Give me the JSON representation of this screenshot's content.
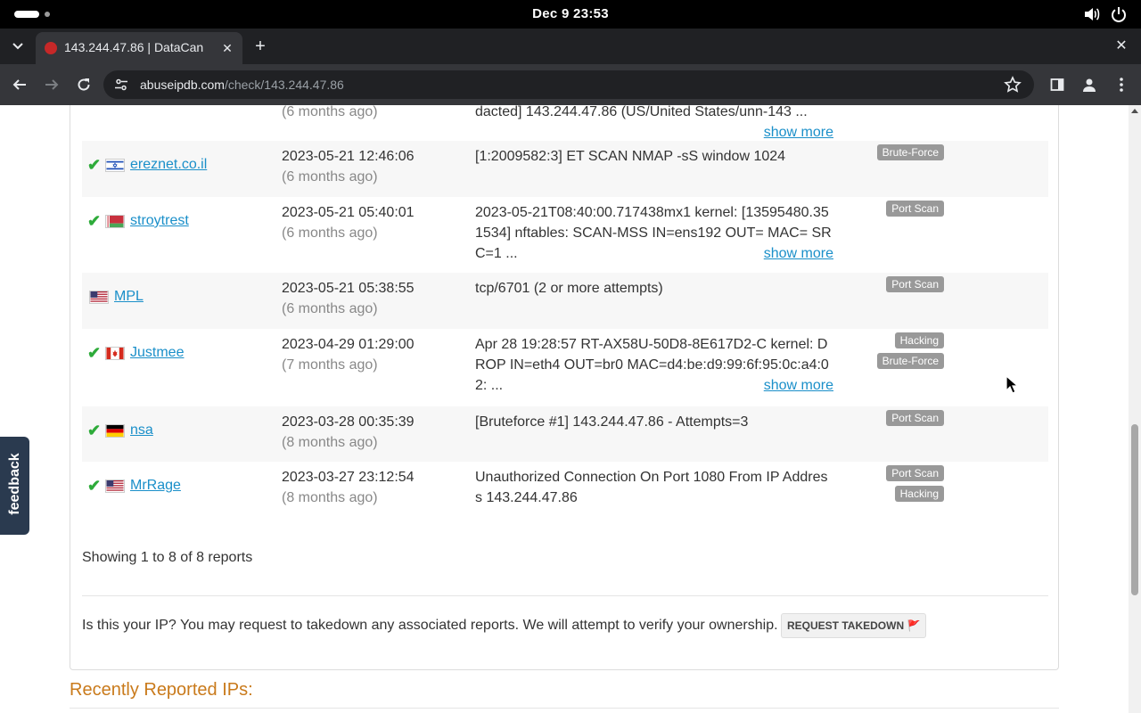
{
  "os": {
    "clock": "Dec 9  23:53"
  },
  "browser": {
    "tab_title": "143.244.47.86 | DataCan",
    "url_host": "abuseipdb.com",
    "url_path": "/check/143.244.47.86"
  },
  "reports": {
    "partial_top": {
      "ago": "(6 months ago)",
      "comment": "dacted] 143.244.47.86 (US/United States/unn-143 ...",
      "show_more": "show more"
    },
    "rows": [
      {
        "reporter": "ereznet.co.il",
        "flag": "il-flag-icon",
        "verified": true,
        "date": "2023-05-21 12:46:06",
        "ago": "(6 months ago)",
        "comment": "[1:2009582:3] ET SCAN NMAP -sS window 1024",
        "show_more": "",
        "categories": [
          "Brute-Force"
        ]
      },
      {
        "reporter": "stroytrest",
        "flag": "by-flag-icon",
        "verified": true,
        "date": "2023-05-21 05:40:01",
        "ago": "(6 months ago)",
        "comment": "2023-05-21T08:40:00.717438mx1 kernel: [13595480.351534] nftables: SCAN-MSS IN=ens192 OUT= MAC= SRC=1 ...",
        "show_more": "show more",
        "categories": [
          "Port Scan"
        ]
      },
      {
        "reporter": "MPL",
        "flag": "us-flag-icon",
        "verified": false,
        "date": "2023-05-21 05:38:55",
        "ago": "(6 months ago)",
        "comment": "tcp/6701 (2 or more attempts)",
        "show_more": "",
        "categories": [
          "Port Scan"
        ]
      },
      {
        "reporter": "Justmee",
        "flag": "ca-flag-icon",
        "verified": true,
        "date": "2023-04-29 01:29:00",
        "ago": "(7 months ago)",
        "comment": "Apr 28 19:28:57 RT-AX58U-50D8-8E617D2-C kernel: DROP IN=eth4 OUT=br0 MAC=d4:be:d9:99:6f:95:0c:a4:02: ...",
        "show_more": "show more",
        "categories": [
          "Hacking",
          "Brute-Force"
        ]
      },
      {
        "reporter": "nsa",
        "flag": "de-flag-icon",
        "verified": true,
        "date": "2023-03-28 00:35:39",
        "ago": "(8 months ago)",
        "comment": "[Bruteforce #1] 143.244.47.86 - Attempts=3",
        "show_more": "",
        "categories": [
          "Port Scan"
        ]
      },
      {
        "reporter": "MrRage",
        "flag": "us-flag-icon",
        "verified": true,
        "date": "2023-03-27 23:12:54",
        "ago": "(8 months ago)",
        "comment": "Unauthorized Connection On Port 1080 From IP Address 143.244.47.86",
        "show_more": "",
        "categories": [
          "Port Scan",
          "Hacking"
        ]
      }
    ],
    "showing": "Showing 1 to 8 of 8 reports",
    "takedown_text": "Is this your IP? You may request to takedown any associated reports. We will attempt to verify your ownership.",
    "takedown_button": "REQUEST TAKEDOWN 🚩"
  },
  "recent_heading": "Recently Reported IPs:",
  "feedback_label": "feedback",
  "colors": {
    "link": "#1a8fc9",
    "check": "#2eab3a",
    "badge": "#999999",
    "accent": "#c97a1b"
  }
}
